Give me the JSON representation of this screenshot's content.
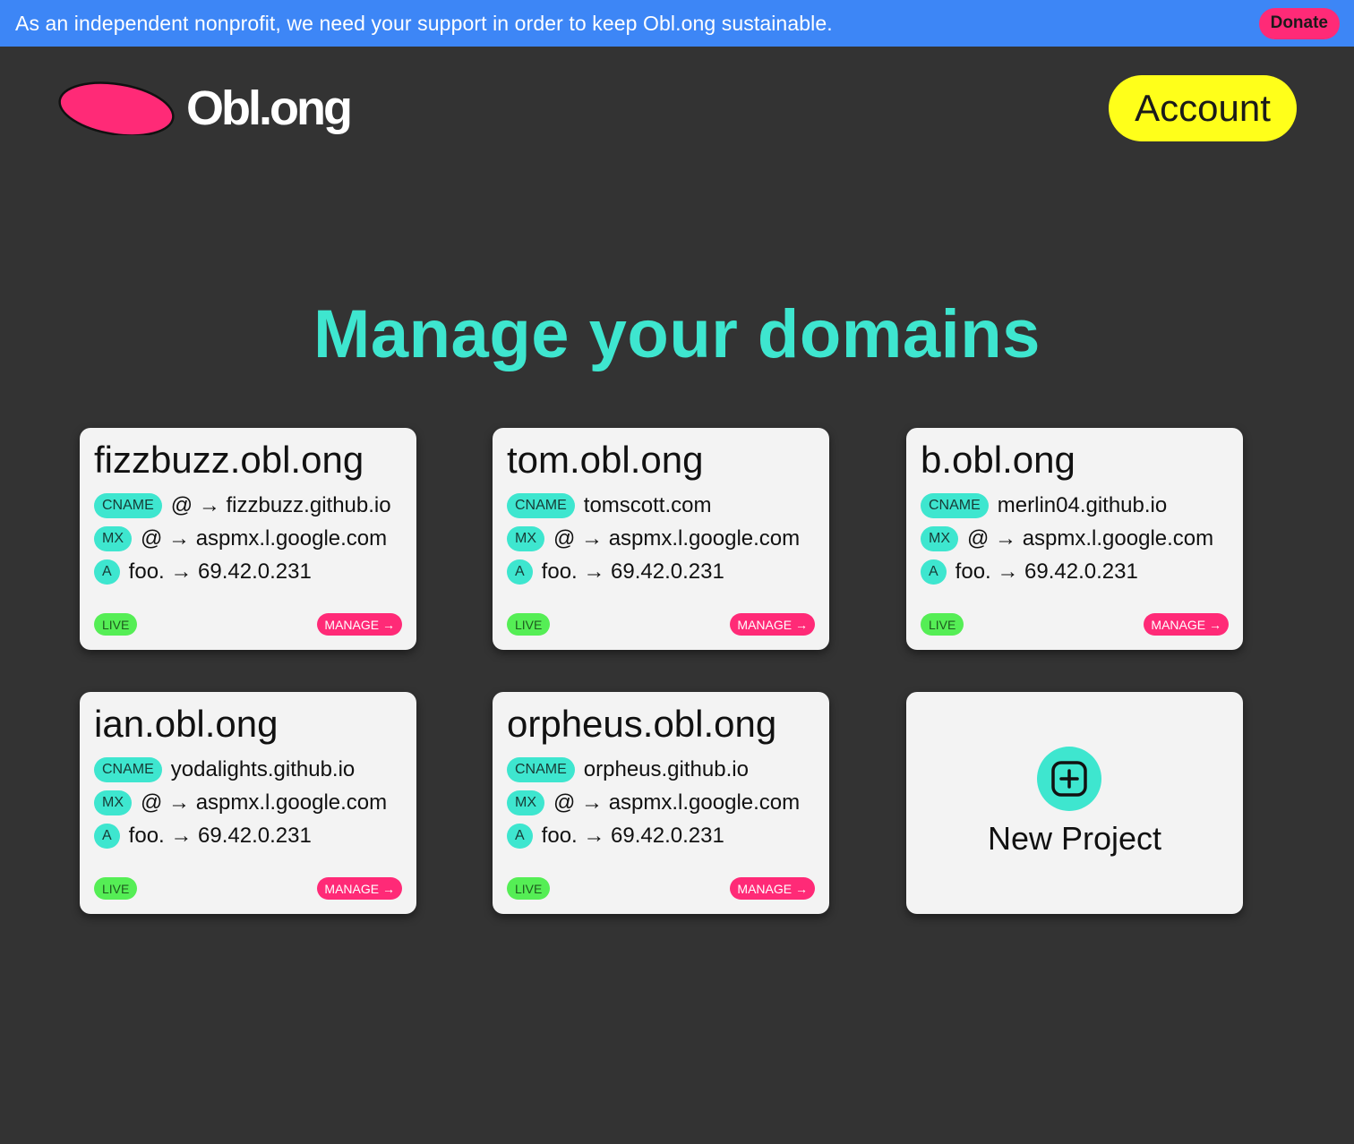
{
  "banner": {
    "text": "As an independent nonprofit, we need your support in order to keep Obl.ong sustainable.",
    "donate_label": "Donate"
  },
  "header": {
    "logo_text": "Obl.ong",
    "account_label": "Account"
  },
  "main": {
    "title": "Manage your domains"
  },
  "domains": [
    {
      "name": "fizzbuzz.obl.ong",
      "records": [
        {
          "type": "CNAME",
          "value": "@ → fizzbuzz.github.io"
        },
        {
          "type": "MX",
          "value": "@ → aspmx.l.google.com"
        },
        {
          "type": "A",
          "value": "foo. → 69.42.0.231"
        }
      ],
      "status": "LIVE",
      "manage_label": "MANAGE →"
    },
    {
      "name": "tom.obl.ong",
      "records": [
        {
          "type": "CNAME",
          "value": "tomscott.com"
        },
        {
          "type": "MX",
          "value": "@ → aspmx.l.google.com"
        },
        {
          "type": "A",
          "value": "foo. → 69.42.0.231"
        }
      ],
      "status": "LIVE",
      "manage_label": "MANAGE →"
    },
    {
      "name": "b.obl.ong",
      "records": [
        {
          "type": "CNAME",
          "value": "merlin04.github.io"
        },
        {
          "type": "MX",
          "value": "@ → aspmx.l.google.com"
        },
        {
          "type": "A",
          "value": "foo. → 69.42.0.231"
        }
      ],
      "status": "LIVE",
      "manage_label": "MANAGE →"
    },
    {
      "name": "ian.obl.ong",
      "records": [
        {
          "type": "CNAME",
          "value": "yodalights.github.io"
        },
        {
          "type": "MX",
          "value": "@ → aspmx.l.google.com"
        },
        {
          "type": "A",
          "value": "foo. → 69.42.0.231"
        }
      ],
      "status": "LIVE",
      "manage_label": "MANAGE →"
    },
    {
      "name": "orpheus.obl.ong",
      "records": [
        {
          "type": "CNAME",
          "value": "orpheus.github.io"
        },
        {
          "type": "MX",
          "value": "@ → aspmx.l.google.com"
        },
        {
          "type": "A",
          "value": "foo. → 69.42.0.231"
        }
      ],
      "status": "LIVE",
      "manage_label": "MANAGE →"
    }
  ],
  "new_project": {
    "label": "New Project",
    "icon": "plus-square-icon"
  },
  "colors": {
    "background": "#333333",
    "banner": "#3d86f6",
    "accent_teal": "#3ee6cf",
    "accent_pink": "#ff2a77",
    "accent_yellow": "#ffff1a",
    "live_green": "#55ee55"
  }
}
